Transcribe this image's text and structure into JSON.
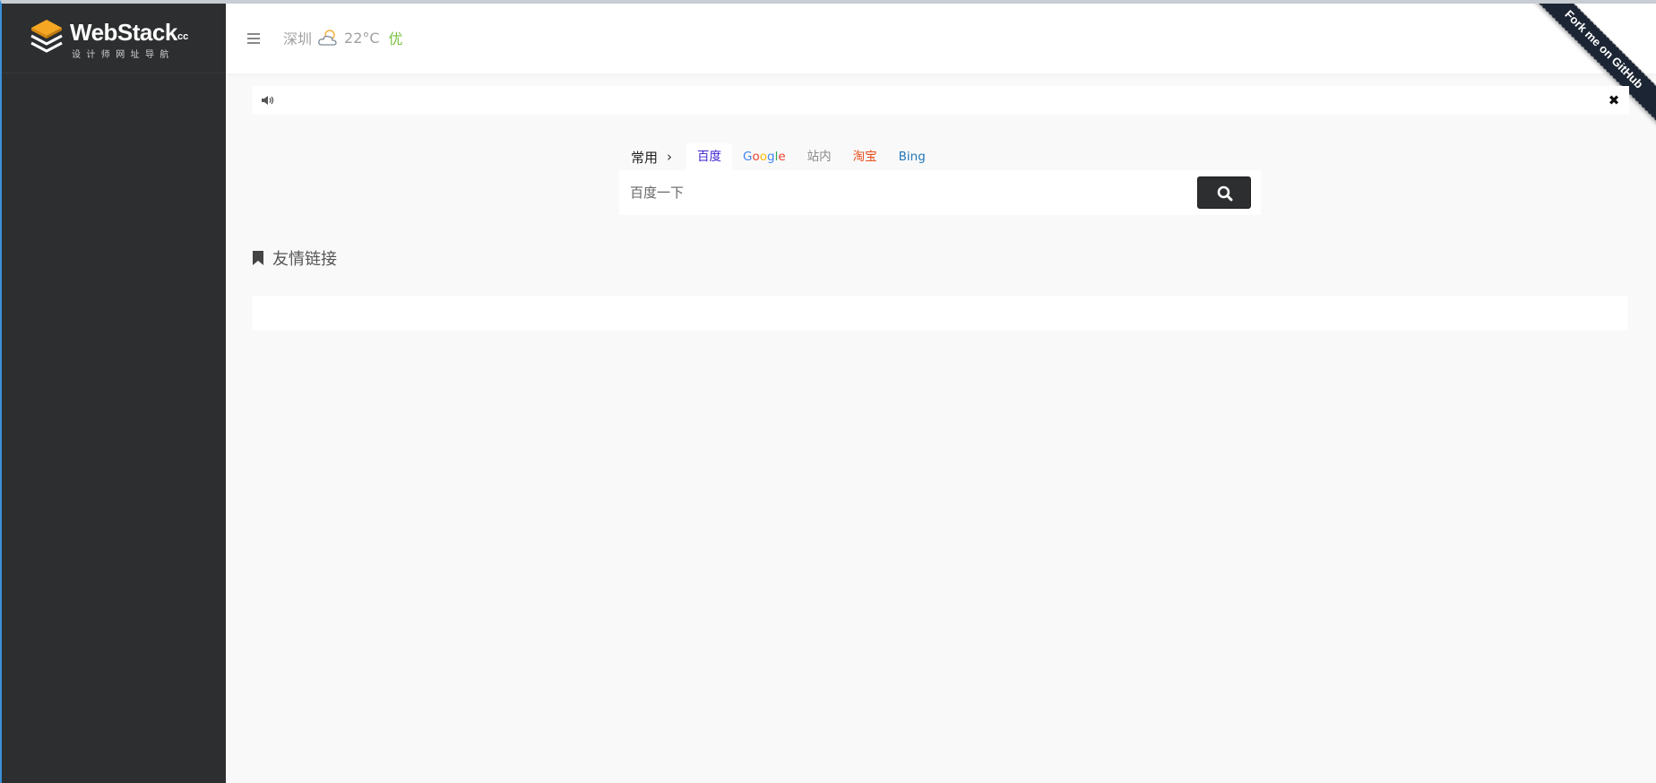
{
  "sidebar": {
    "logo": {
      "wordmark": "WebStack",
      "suffix": ".cc",
      "tagline": "设计师网址导航"
    }
  },
  "topbar": {
    "weather": {
      "city": "深圳",
      "icon": "partly-cloudy-icon",
      "temperature": "22°C",
      "air_quality": "优",
      "air_quality_color": "#7ac143"
    },
    "ribbon": {
      "text": "Fork me on GitHub",
      "color": "#1c2533"
    }
  },
  "notice": {
    "icon": "speaker-icon",
    "close_label": "✖"
  },
  "search": {
    "group_label": "常用",
    "engines": [
      {
        "label": "百度",
        "color": "#3b1fd0",
        "active": true
      },
      {
        "label": "Google",
        "active": false
      },
      {
        "label": "站内",
        "color": "#8a8a8a",
        "active": false
      },
      {
        "label": "淘宝",
        "color": "#e8501f",
        "active": false
      },
      {
        "label": "Bing",
        "color": "#2578b8",
        "active": false
      }
    ],
    "placeholder": "百度一下",
    "button_icon": "search-icon"
  },
  "section": {
    "title": "友情链接",
    "icon": "bookmark-icon"
  },
  "colors": {
    "sidebar": "#2c2e2f",
    "background": "#f9f9f9",
    "accent": "#f5a623"
  }
}
